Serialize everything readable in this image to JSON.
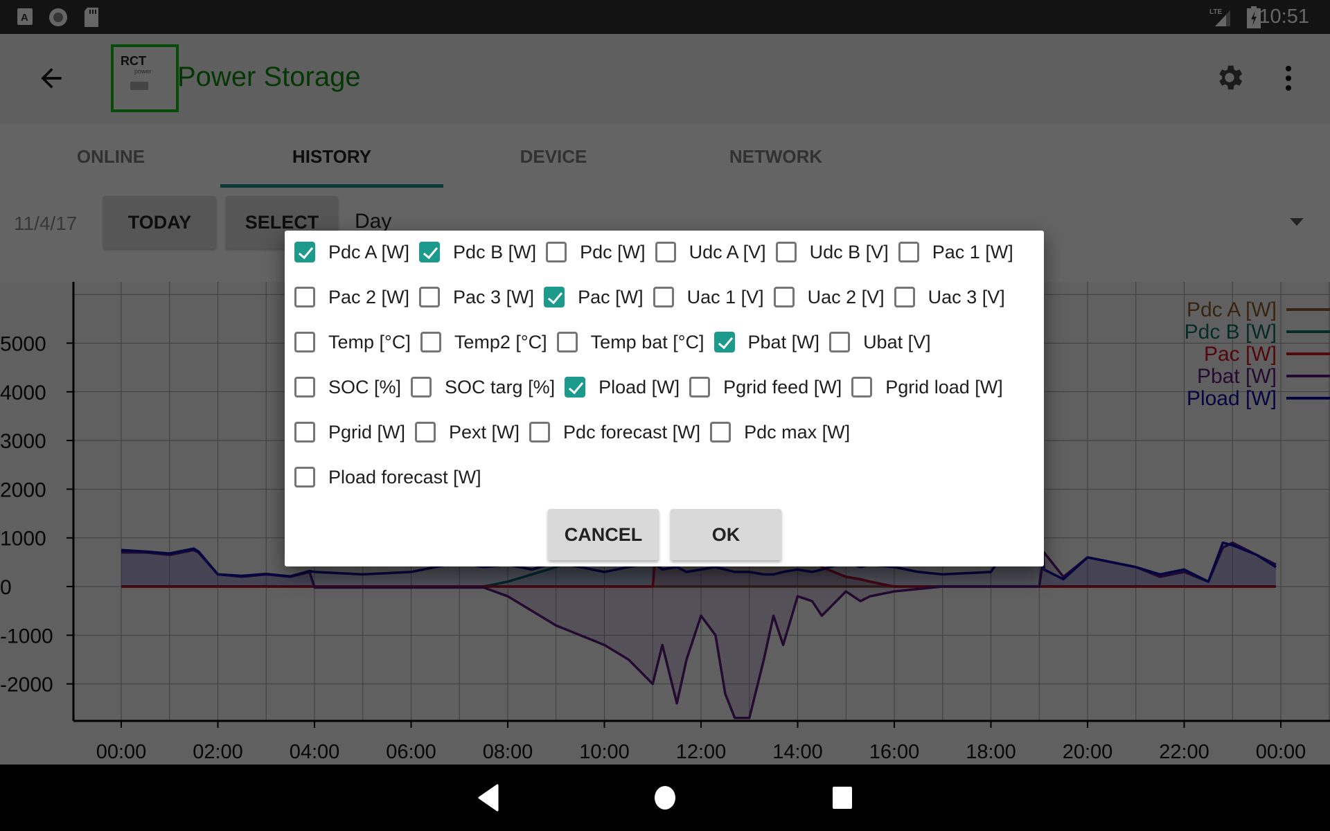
{
  "status_bar": {
    "time": "10:51",
    "icons": [
      "a-notification-icon",
      "record-icon",
      "sd-card-icon",
      "lte-signal-icon",
      "battery-charging-icon"
    ],
    "network": "LTE"
  },
  "app_bar": {
    "title": "Power Storage",
    "logo_text": "RCT",
    "logo_subtext": "power",
    "icons": [
      "back-arrow-icon",
      "gear-icon",
      "overflow-menu-icon"
    ],
    "title_color": "#0b8a0b"
  },
  "tabs": [
    {
      "label": "ONLINE",
      "active": false
    },
    {
      "label": "HISTORY",
      "active": true
    },
    {
      "label": "DEVICE",
      "active": false
    },
    {
      "label": "NETWORK",
      "active": false
    }
  ],
  "toolbar": {
    "date": "11/4/17",
    "today_label": "TODAY",
    "select_label": "SELECT",
    "period_value": "Day"
  },
  "dialog": {
    "rows": [
      [
        {
          "label": "Pdc A [W]",
          "checked": true
        },
        {
          "label": "Pdc B [W]",
          "checked": true
        },
        {
          "label": "Pdc [W]",
          "checked": false
        },
        {
          "label": "Udc A [V]",
          "checked": false
        },
        {
          "label": "Udc B [V]",
          "checked": false
        },
        {
          "label": "Pac 1 [W]",
          "checked": false
        }
      ],
      [
        {
          "label": "Pac 2 [W]",
          "checked": false
        },
        {
          "label": "Pac 3 [W]",
          "checked": false
        },
        {
          "label": "Pac [W]",
          "checked": true
        },
        {
          "label": "Uac 1 [V]",
          "checked": false
        },
        {
          "label": "Uac 2 [V]",
          "checked": false
        },
        {
          "label": "Uac 3 [V]",
          "checked": false
        }
      ],
      [
        {
          "label": "Temp [°C]",
          "checked": false
        },
        {
          "label": "Temp2 [°C]",
          "checked": false
        },
        {
          "label": "Temp bat [°C]",
          "checked": false
        },
        {
          "label": "Pbat [W]",
          "checked": true
        },
        {
          "label": "Ubat [V]",
          "checked": false
        }
      ],
      [
        {
          "label": "SOC [%]",
          "checked": false
        },
        {
          "label": "SOC targ [%]",
          "checked": false
        },
        {
          "label": "Pload [W]",
          "checked": true
        },
        {
          "label": "Pgrid feed [W]",
          "checked": false
        },
        {
          "label": "Pgrid load [W]",
          "checked": false
        }
      ],
      [
        {
          "label": "Pgrid [W]",
          "checked": false
        },
        {
          "label": "Pext [W]",
          "checked": false
        },
        {
          "label": "Pdc forecast [W]",
          "checked": false
        },
        {
          "label": "Pdc max [W]",
          "checked": false
        }
      ],
      [
        {
          "label": "Pload forecast [W]",
          "checked": false
        }
      ]
    ],
    "cancel_label": "CANCEL",
    "ok_label": "OK",
    "accent": "#1c9a8c"
  },
  "chart_data": {
    "type": "line",
    "title": "",
    "xlabel": "",
    "ylabel": "",
    "x_ticks": [
      "00:00",
      "02:00",
      "04:00",
      "06:00",
      "08:00",
      "10:00",
      "12:00",
      "14:00",
      "16:00",
      "18:00",
      "20:00",
      "22:00",
      "00:00"
    ],
    "y_ticks": [
      -2000,
      -1000,
      0,
      1000,
      2000,
      3000,
      4000,
      5000
    ],
    "xlim_hours": [
      0,
      24
    ],
    "ylim": [
      -2750,
      6000
    ],
    "grid": true,
    "legend_position": "top-right",
    "x_hours": [
      0,
      0.5,
      1,
      1.5,
      1.6,
      2,
      2.5,
      3,
      3.5,
      3.9,
      4,
      5,
      6,
      7,
      7.5,
      8,
      8.5,
      9,
      9.5,
      10,
      10.5,
      11,
      11.2,
      11.5,
      11.7,
      12,
      12.3,
      12.5,
      12.7,
      13,
      13.3,
      13.5,
      13.7,
      14,
      14.3,
      14.5,
      15,
      15.3,
      15.5,
      16,
      16.5,
      17,
      18,
      19,
      19.1,
      19.5,
      20,
      20.5,
      21,
      21.5,
      22,
      22.5,
      22.8,
      23,
      23.5,
      23.9
    ],
    "series": [
      {
        "name": "Pdc A [W]",
        "color": "#8b5a2b",
        "values": [
          0,
          0,
          0,
          0,
          0,
          0,
          0,
          0,
          0,
          0,
          0,
          0,
          0,
          0,
          0,
          0,
          0,
          0,
          0,
          0,
          0,
          0,
          0,
          0,
          0,
          0,
          0,
          0,
          0,
          0,
          0,
          0,
          0,
          0,
          0,
          0,
          0,
          0,
          0,
          0,
          0,
          0,
          0,
          0,
          0,
          0,
          0,
          0,
          0,
          0,
          0,
          0,
          0,
          0,
          0,
          0
        ]
      },
      {
        "name": "Pdc B [W]",
        "color": "#0d6e63",
        "values": [
          0,
          0,
          0,
          0,
          0,
          0,
          0,
          0,
          0,
          0,
          0,
          0,
          0,
          0,
          0,
          100,
          250,
          400,
          600,
          900,
          1300,
          1800,
          2100,
          2400,
          2600,
          2800,
          2700,
          2600,
          2500,
          2200,
          1900,
          1600,
          1200,
          900,
          600,
          400,
          200,
          150,
          100,
          0,
          0,
          0,
          0,
          0,
          0,
          0,
          0,
          0,
          0,
          0,
          0,
          0,
          0,
          0,
          0,
          0
        ]
      },
      {
        "name": "Pac [W]",
        "color": "#d0101c",
        "values": [
          0,
          0,
          0,
          0,
          0,
          0,
          0,
          0,
          0,
          0,
          0,
          0,
          0,
          0,
          0,
          0,
          0,
          0,
          0,
          0,
          0,
          0,
          2200,
          2400,
          2600,
          2800,
          2700,
          2600,
          2500,
          2200,
          1900,
          1600,
          1200,
          900,
          600,
          400,
          200,
          150,
          100,
          0,
          0,
          0,
          0,
          0,
          0,
          0,
          0,
          0,
          0,
          0,
          0,
          0,
          0,
          0,
          0,
          0
        ]
      },
      {
        "name": "Pbat [W]",
        "color": "#5b1a7a",
        "values": [
          700,
          700,
          650,
          750,
          700,
          250,
          200,
          250,
          200,
          300,
          -20,
          -20,
          -20,
          -20,
          -20,
          -200,
          -500,
          -800,
          -1000,
          -1200,
          -1500,
          -2000,
          -1200,
          -2400,
          -1500,
          -600,
          -1000,
          -2200,
          -2700,
          -2700,
          -1500,
          -600,
          -1200,
          -200,
          -300,
          -600,
          -100,
          -300,
          -200,
          -100,
          -50,
          0,
          0,
          0,
          700,
          200,
          600,
          500,
          400,
          200,
          300,
          100,
          800,
          900,
          650,
          450
        ]
      },
      {
        "name": "Pload [W]",
        "color": "#0a0aa0",
        "values": [
          750,
          720,
          680,
          780,
          720,
          250,
          220,
          260,
          210,
          320,
          300,
          250,
          300,
          500,
          400,
          450,
          350,
          500,
          400,
          300,
          400,
          500,
          350,
          400,
          300,
          350,
          400,
          350,
          300,
          300,
          250,
          250,
          300,
          350,
          300,
          350,
          500,
          400,
          450,
          400,
          300,
          250,
          300,
          1800,
          350,
          150,
          600,
          500,
          400,
          250,
          350,
          100,
          900,
          850,
          650,
          400
        ]
      }
    ]
  }
}
